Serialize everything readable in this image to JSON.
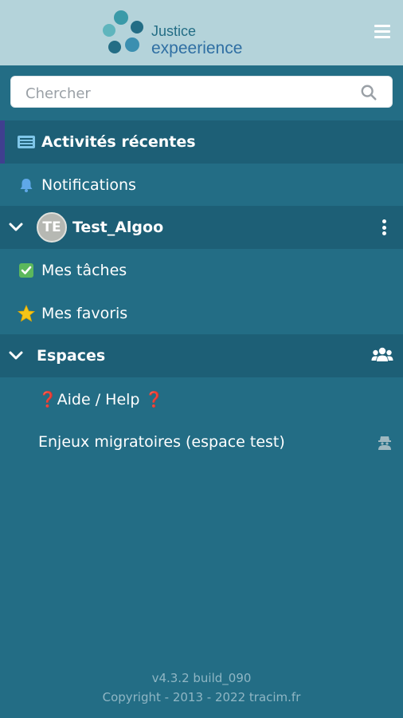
{
  "header": {
    "logo_line1": "Justice",
    "logo_line2": "expeerience",
    "menu_icon": "hamburger-icon"
  },
  "search": {
    "placeholder": "Chercher",
    "icon": "search-icon"
  },
  "nav": {
    "recent_activities": "Activités récentes",
    "notifications": "Notifications"
  },
  "user": {
    "initials": "TE",
    "name": "Test_Algoo",
    "tasks": "Mes tâches",
    "favorites": "Mes favoris"
  },
  "spaces": {
    "title": "Espaces",
    "items": [
      {
        "label": "❓Aide / Help ❓"
      },
      {
        "label": "Enjeux migratoires (espace test)"
      }
    ]
  },
  "footer": {
    "version": "v4.3.2 build_090",
    "copyright": "Copyright - 2013 - 2022 tracim.fr"
  },
  "colors": {
    "header_bg": "#b4d3da",
    "sidebar_bg": "#236d85",
    "active_accent": "#3f3f8f"
  }
}
